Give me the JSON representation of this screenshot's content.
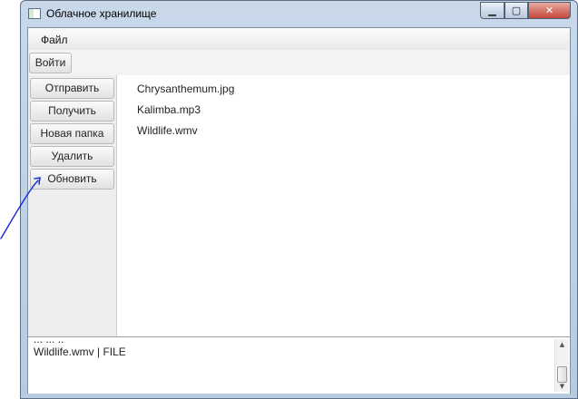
{
  "window": {
    "title": "Облачное хранилище",
    "minimize_glyph": "▁",
    "maximize_glyph": "▢",
    "close_glyph": "✕"
  },
  "menu": {
    "items": [
      {
        "label": "Файл"
      }
    ]
  },
  "toolbar": {
    "login_label": "Войти"
  },
  "sidebar": {
    "buttons": [
      {
        "label": "Отправить"
      },
      {
        "label": "Получить"
      },
      {
        "label": "Новая папка"
      },
      {
        "label": "Удалить"
      },
      {
        "label": "Обновить"
      }
    ]
  },
  "files": [
    {
      "name": "Chrysanthemum.jpg"
    },
    {
      "name": "Kalimba.mp3"
    },
    {
      "name": "Wildlife.wmv"
    }
  ],
  "log": {
    "clipped_line": "... ... ..",
    "line": "Wildlife.wmv | FILE"
  },
  "annotation": {
    "color": "#1a2ed8",
    "description_icon": "pen-arrow-icon"
  }
}
